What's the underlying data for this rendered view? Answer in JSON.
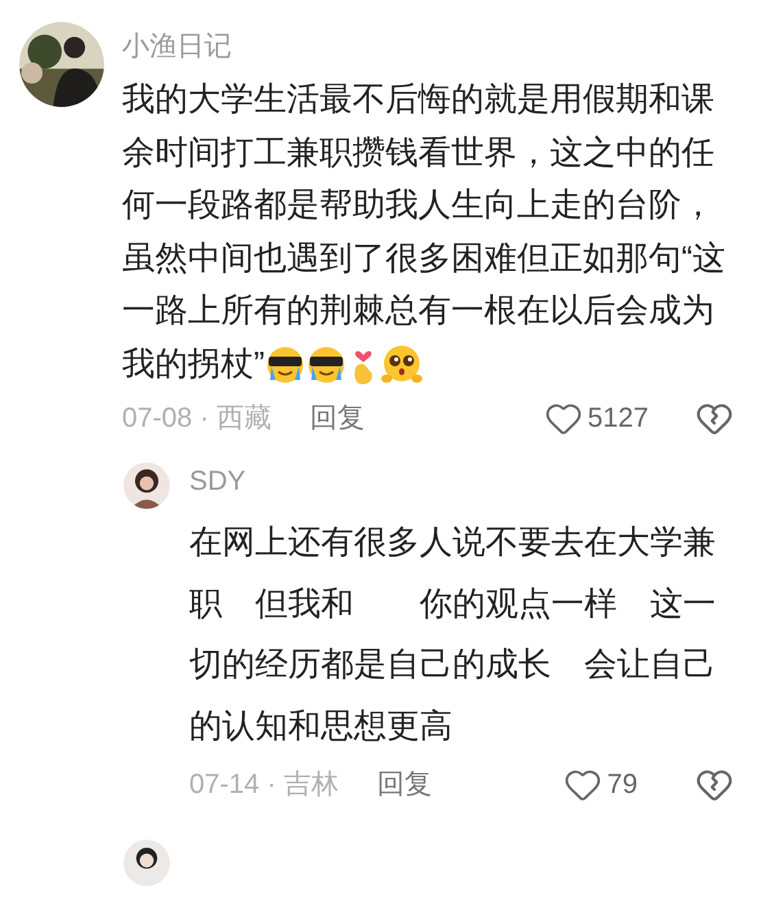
{
  "comment": {
    "author": "小渔日记",
    "lines": [
      "我的大学生活最不后悔的就是用假期和课",
      "余时间打工兼职攒钱看世界，这之中的任",
      "何一段路都是帮助我人生向上走的台阶，",
      "虽然中间也遇到了很多困难但正如那句“这",
      "一路上所有的荆棘总有一根在以后会成为",
      "我的拐杖”"
    ],
    "date_location": "07-08 · 西藏",
    "reply_label": "回复",
    "likes": "5127"
  },
  "reply": {
    "author": "SDY",
    "lines": [
      "在网上还有很多人说不要去在大学兼",
      "职　但我和　　你的观点一样　这一",
      "切的经历都是自己的成长　会让自己",
      "的认知和思想更高"
    ],
    "date_location": "07-14 · 吉林",
    "reply_label": "回复",
    "likes": "79"
  }
}
